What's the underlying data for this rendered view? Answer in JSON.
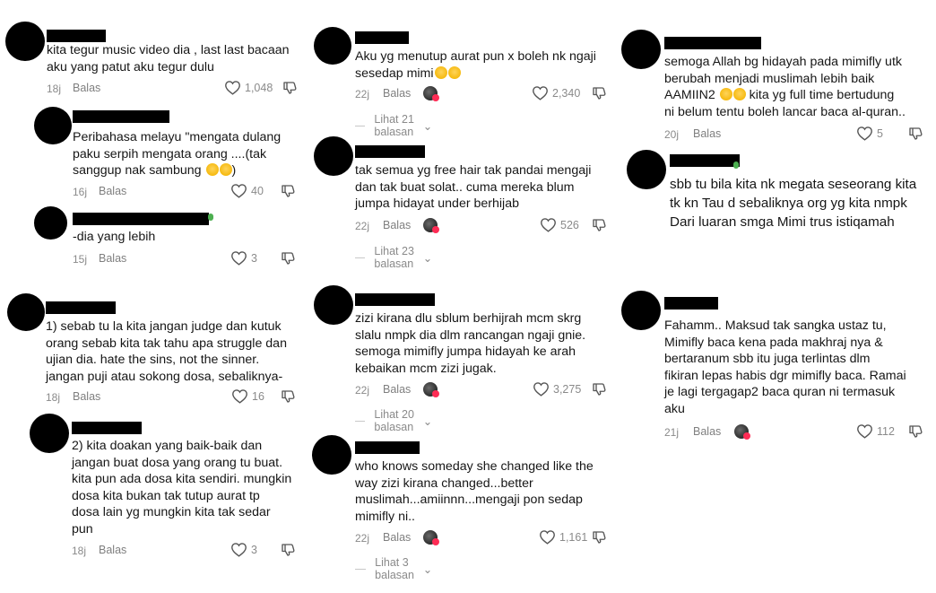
{
  "labels": {
    "reply": "Balas"
  },
  "col1": [
    {
      "text": "kita tegur music video dia , last last bacaan\naku yang patut aku tegur dulu",
      "age": "18j",
      "likes": "1,048"
    },
    {
      "text": "Peribahasa melayu \"mengata dulang\npaku serpih mengata orang ....(tak\nsanggup nak sambung",
      "age": "16j",
      "likes": "40"
    },
    {
      "text": "-dia yang lebih",
      "age": "15j",
      "likes": "3"
    },
    {
      "text": "1) sebab tu la kita jangan judge dan kutuk\norang sebab kita tak tahu apa struggle dan\nujian dia. hate the sins, not the sinner.\njangan puji atau sokong dosa, sebaliknya-",
      "age": "18j",
      "likes": "16"
    },
    {
      "text": "2) kita doakan yang baik-baik dan\njangan buat dosa yang orang tu buat.\nkita pun ada dosa kita sendiri. mungkin\ndosa kita bukan tak tutup aurat tp\ndosa lain yg mungkin kita tak sedar\npun",
      "age": "18j",
      "likes": "3"
    }
  ],
  "col2": [
    {
      "text": "Aku yg menutup aurat pun x boleh nk ngaji\nsesedap mimi",
      "age": "22j",
      "likes": "2,340",
      "replies": "Lihat 21 balasan"
    },
    {
      "text": "tak semua yg free hair tak pandai mengaji\ndan tak buat solat.. cuma mereka blum\njumpa hidayat under berhijab",
      "age": "22j",
      "likes": "526",
      "replies": "Lihat 23 balasan"
    },
    {
      "text": "zizi kirana dlu sblum berhijrah mcm skrg\nslalu nmpk dia dlm rancangan ngaji gnie.\nsemoga mimifly jumpa hidayah ke arah\nkebaikan mcm zizi jugak.",
      "age": "22j",
      "likes": "3,275",
      "replies": "Lihat 20 balasan"
    },
    {
      "text": "who knows someday she changed like the\nway zizi kirana changed...better\nmuslimah...amiinnn...mengaji pon sedap\nmimifly ni..",
      "age": "22j",
      "likes": "1,161",
      "replies": "Lihat 3 balasan"
    }
  ],
  "col3": [
    {
      "text": "semoga Allah bg hidayah pada mimifly utk\nberubah menjadi muslimah lebih baik\nAAMIIN2",
      "text_tail": " kita yg full time bertudung\nni belum tentu boleh lancar baca al-quran..",
      "age": "20j",
      "likes": "5"
    },
    {
      "text": "sbb tu bila kita nk megata seseorang kita\ntk kn Tau d sebaliknya org yg kita nmpk\nDari luaran smga Mimi trus istiqamah"
    },
    {
      "text": "Fahamm.. Maksud tak sangka ustaz tu,\nMimifly baca kena pada makhraj nya &\nbertaranum sbb itu juga terlintas dlm\nfikiran lepas habis dgr mimifly baca. Ramai\nje lagi tergagap2 baca quran ni termasuk\naku",
      "age": "21j",
      "likes": "112"
    }
  ]
}
